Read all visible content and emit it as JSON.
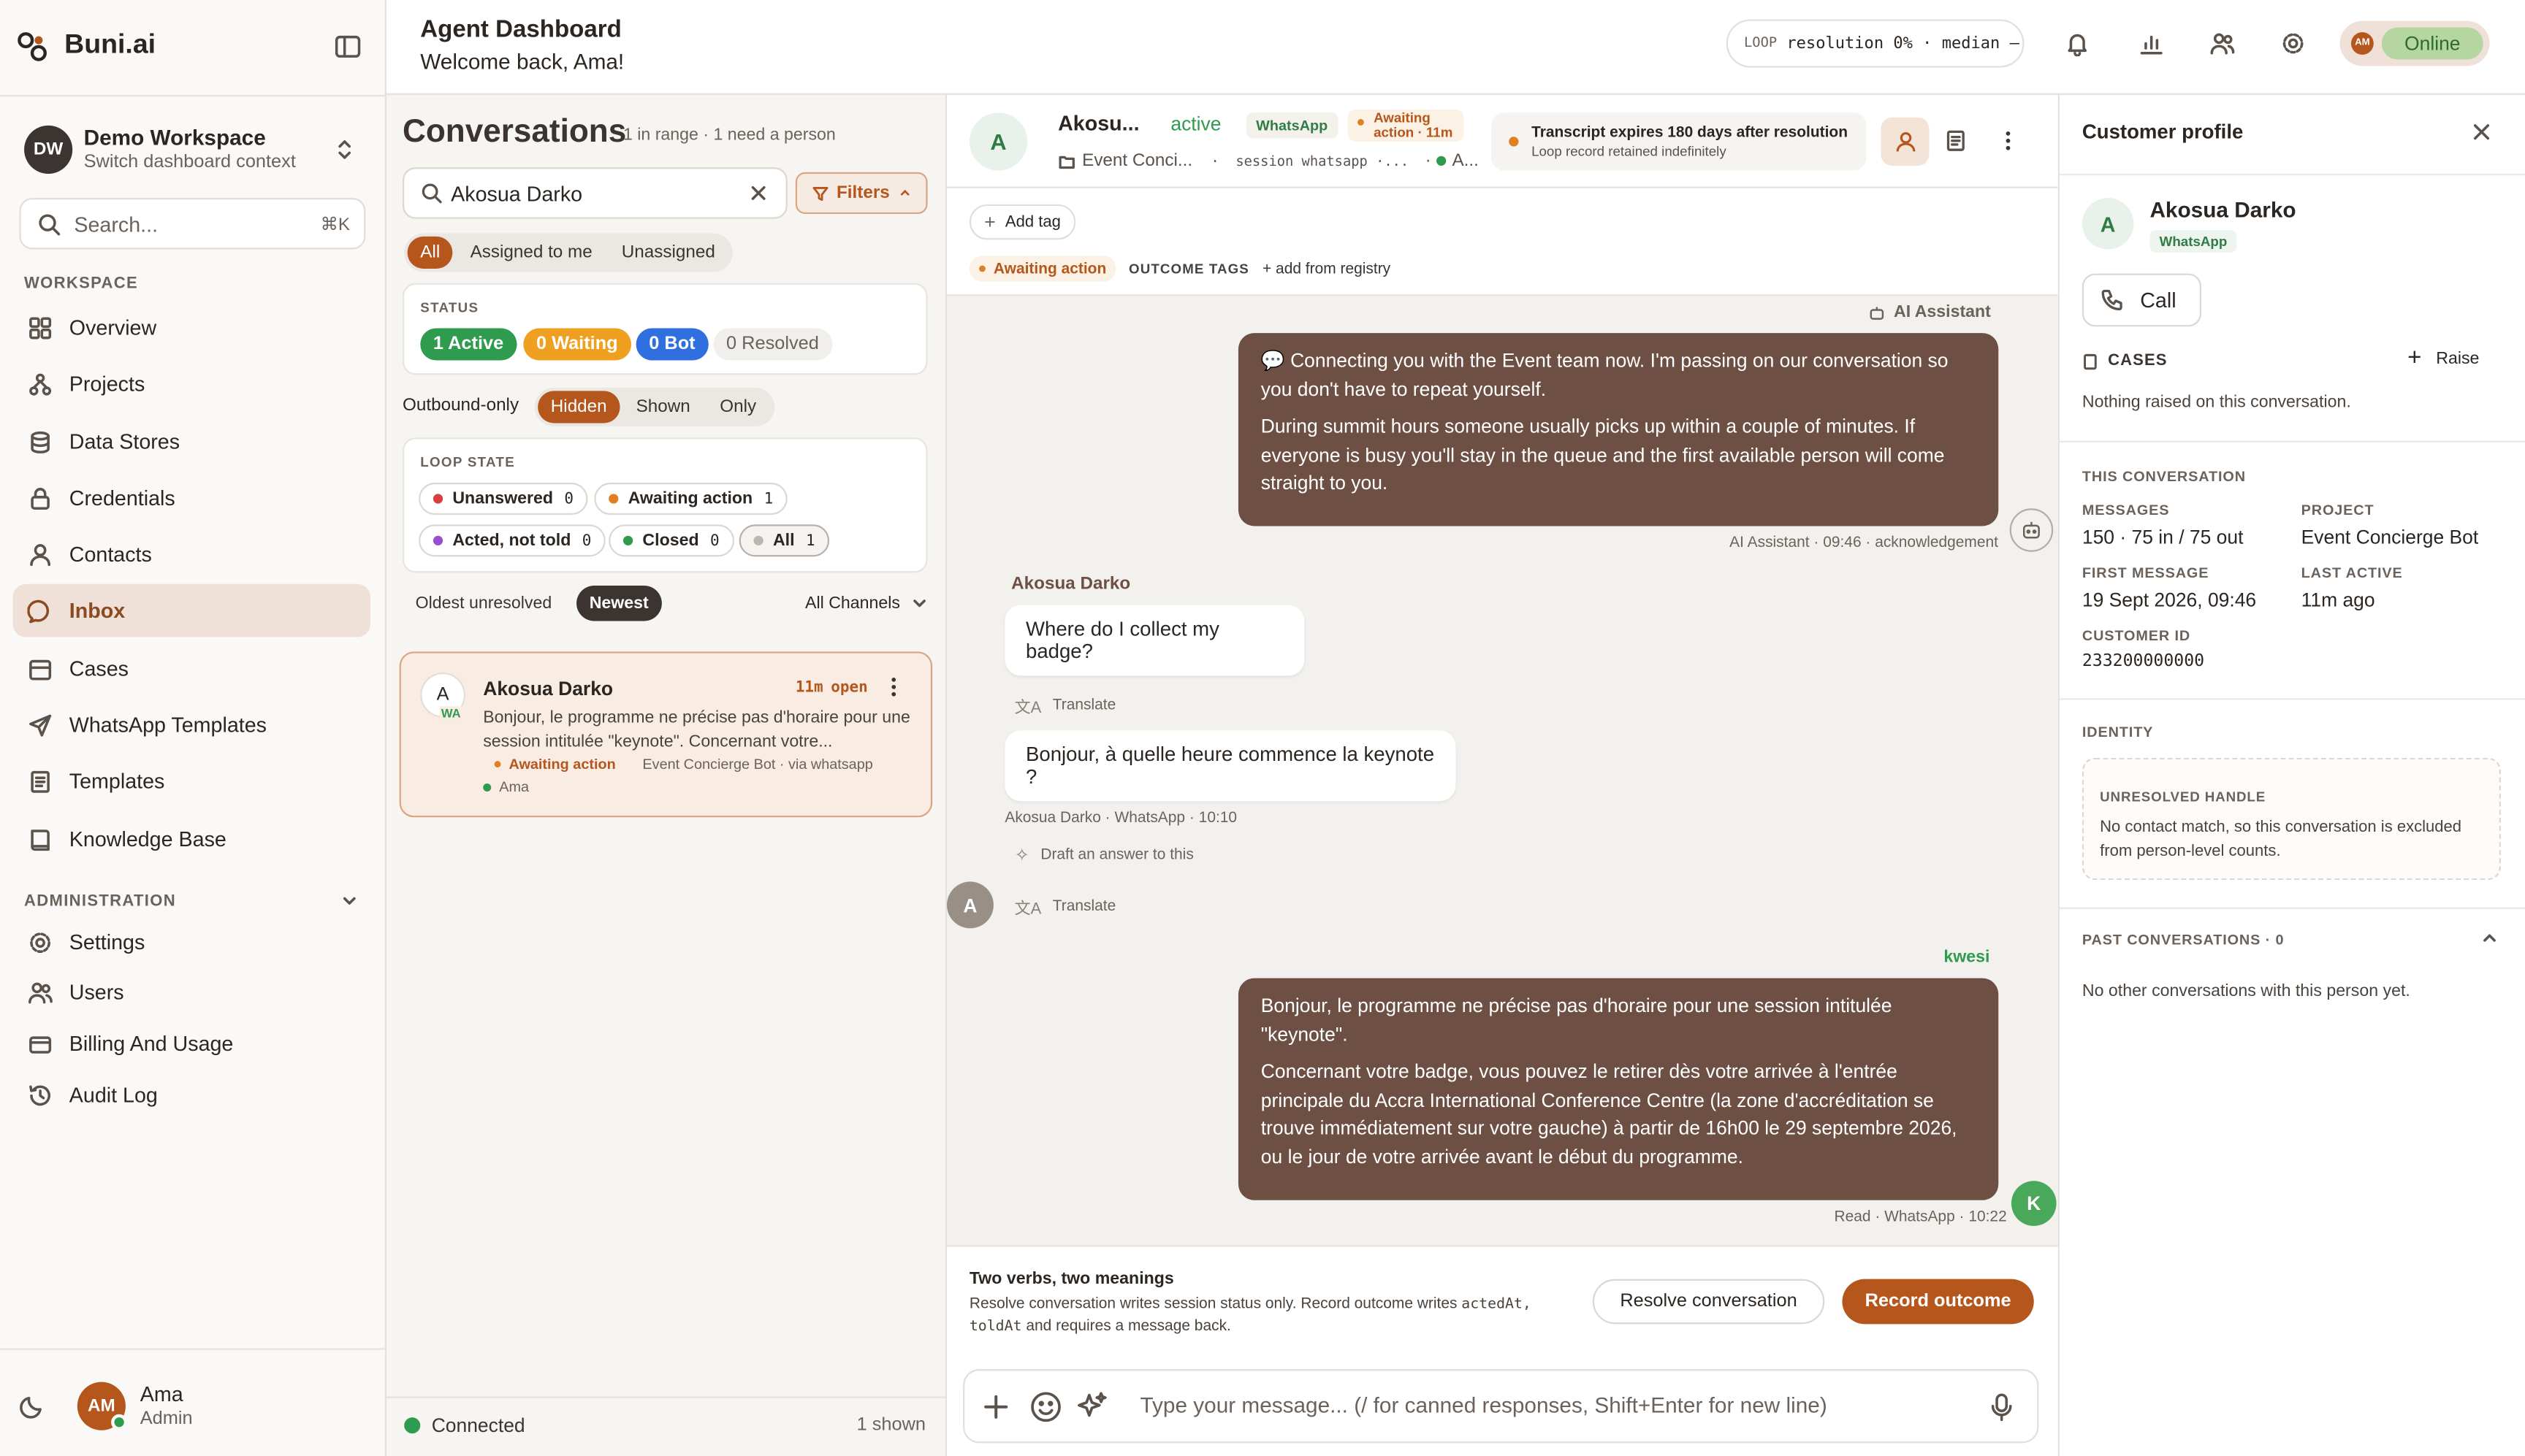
{
  "colors": {
    "accent": "#b5561c",
    "bubble": "#6e4f43",
    "active_green": "#2e9b4f",
    "waiting_orange": "#f0a020",
    "bot_blue": "#2f6fe0",
    "online_green": "#b5d6a0"
  },
  "sidebar": {
    "brand": "Buni.ai",
    "workspace": {
      "initials": "DW",
      "name": "Demo Workspace",
      "subtitle": "Switch dashboard context"
    },
    "search": {
      "placeholder": "Search...",
      "shortcut": "⌘K"
    },
    "workspace_label": "WORKSPACE",
    "workspace_items": [
      {
        "label": "Overview",
        "icon": "grid-icon"
      },
      {
        "label": "Projects",
        "icon": "projects-icon"
      },
      {
        "label": "Data Stores",
        "icon": "database-icon"
      },
      {
        "label": "Credentials",
        "icon": "lock-icon"
      },
      {
        "label": "Contacts",
        "icon": "person-icon"
      },
      {
        "label": "Inbox",
        "icon": "chat-icon"
      },
      {
        "label": "Cases",
        "icon": "folder-icon"
      },
      {
        "label": "WhatsApp Templates",
        "icon": "send-icon"
      },
      {
        "label": "Templates",
        "icon": "template-icon"
      },
      {
        "label": "Knowledge Base",
        "icon": "book-icon"
      }
    ],
    "admin_label": "ADMINISTRATION",
    "admin_items": [
      {
        "label": "Settings",
        "icon": "gear-icon"
      },
      {
        "label": "Users",
        "icon": "users-icon"
      },
      {
        "label": "Billing And Usage",
        "icon": "billing-icon"
      },
      {
        "label": "Audit Log",
        "icon": "history-icon"
      }
    ],
    "user": {
      "initials": "AM",
      "name": "Ama",
      "role": "Admin"
    }
  },
  "header": {
    "title": "Agent Dashboard",
    "welcome": "Welcome back, Ama!",
    "loop_label": "LOOP",
    "loop_stat": "resolution 0% · median —",
    "status_initials": "AM",
    "status": "Online"
  },
  "conversations": {
    "title": "Conversations",
    "summary": "1 in range · 1 need a person",
    "search_value": "Akosua Darko",
    "filters_label": "Filters",
    "tabs": [
      "All",
      "Assigned to me",
      "Unassigned"
    ],
    "status_label": "STATUS",
    "status_pills": [
      "1 Active",
      "0 Waiting",
      "0 Bot",
      "0 Resolved"
    ],
    "outbound_label": "Outbound-only",
    "outbound_options": [
      "Hidden",
      "Shown",
      "Only"
    ],
    "loop_state_label": "LOOP STATE",
    "loop_chips": [
      {
        "label": "Unanswered",
        "count": "0"
      },
      {
        "label": "Awaiting action",
        "count": "1"
      },
      {
        "label": "Acted, not told",
        "count": "0"
      },
      {
        "label": "Closed",
        "count": "0"
      },
      {
        "label": "All",
        "count": "1"
      }
    ],
    "sort_options": [
      "Oldest unresolved",
      "Newest"
    ],
    "channel_filter": "All Channels",
    "item": {
      "initial": "A",
      "badge": "WA",
      "name": "Akosua Darko",
      "age": "11m",
      "state": "open",
      "preview": "Bonjour, le programme ne précise pas d'horaire pour une session intitulée \"keynote\". Concernant votre...",
      "tag": "Awaiting action",
      "source": "Event Concierge Bot · via whatsapp",
      "assignee": "Ama"
    },
    "footer_status": "Connected",
    "footer_count": "1 shown"
  },
  "chat": {
    "initial": "A",
    "name": "Akosu...",
    "status": "active",
    "channel": "WhatsApp",
    "awaiting": "Awaiting action · 11m",
    "project": "Event Conci...",
    "session": "session whatsapp ·...",
    "assignee_short": "A...",
    "retention_title": "Transcript expires 180 days after resolution",
    "retention_sub": "Loop record retained indefinitely",
    "add_tag": "Add tag",
    "awaiting_tag": "Awaiting action",
    "outcome_tags_label": "OUTCOME TAGS",
    "add_from_registry": "+ add from registry",
    "ai_label": "AI Assistant",
    "ai_message_p1": "💬 Connecting you with the Event team now. I'm passing on our conversation so you don't have to repeat yourself.",
    "ai_message_p2": "During summit hours someone usually picks up within a couple of minutes. If everyone is busy you'll stay in the queue and the first available person will come straight to you.",
    "ai_meta": "AI Assistant · 09:46 · acknowledgement",
    "customer_name": "Akosua Darko",
    "customer_msg1": "Where do I collect my badge?",
    "translate_label": "Translate",
    "customer_msg2": "Bonjour, à quelle heure commence la keynote ?",
    "customer_meta": "Akosua Darko · WhatsApp · 10:10",
    "draft_label": "Draft an answer to this",
    "agent_name": "kwesi",
    "agent_initial": "K",
    "agent_msg_p1": "Bonjour, le programme ne précise pas d'horaire pour une session intitulée \"keynote\".",
    "agent_msg_p2": "Concernant votre badge, vous pouvez le retirer dès votre arrivée à l'entrée principale du Accra International Conference Centre (la zone d'accréditation se trouve immédiatement sur votre gauche) à partir de 16h00 le 29 septembre 2026, ou le jour de votre arrivée avant le début du programme.",
    "agent_meta": "Read · WhatsApp · 10:22",
    "hint_title": "Two verbs, two meanings",
    "hint_line1": "Resolve conversation writes session status only. Record outcome writes",
    "hint_code1": "actedAt,",
    "hint_code2": "toldAt",
    "hint_line2": "and requires a message back.",
    "resolve_button": "Resolve conversation",
    "record_button": "Record outcome",
    "composer_placeholder": "Type your message... (/ for canned responses, Shift+Enter for new line)"
  },
  "profile": {
    "title": "Customer profile",
    "initial": "A",
    "name": "Akosua Darko",
    "channel": "WhatsApp",
    "call_label": "Call",
    "cases_label": "CASES",
    "raise_label": "Raise",
    "cases_empty": "Nothing raised on this conversation.",
    "this_conv_label": "THIS CONVERSATION",
    "messages_label": "MESSAGES",
    "messages_value": "150 · 75 in / 75 out",
    "project_label": "PROJECT",
    "project_value": "Event Concierge Bot",
    "first_label": "FIRST MESSAGE",
    "first_value": "19 Sept 2026, 09:46",
    "last_label": "LAST ACTIVE",
    "last_value": "11m ago",
    "customer_id_label": "CUSTOMER ID",
    "customer_id_value": "233200000000",
    "identity_label": "IDENTITY",
    "unresolved_label": "UNRESOLVED HANDLE",
    "unresolved_text": "No contact match, so this conversation is excluded from person-level counts.",
    "past_label": "PAST CONVERSATIONS · 0",
    "past_empty": "No other conversations with this person yet."
  }
}
